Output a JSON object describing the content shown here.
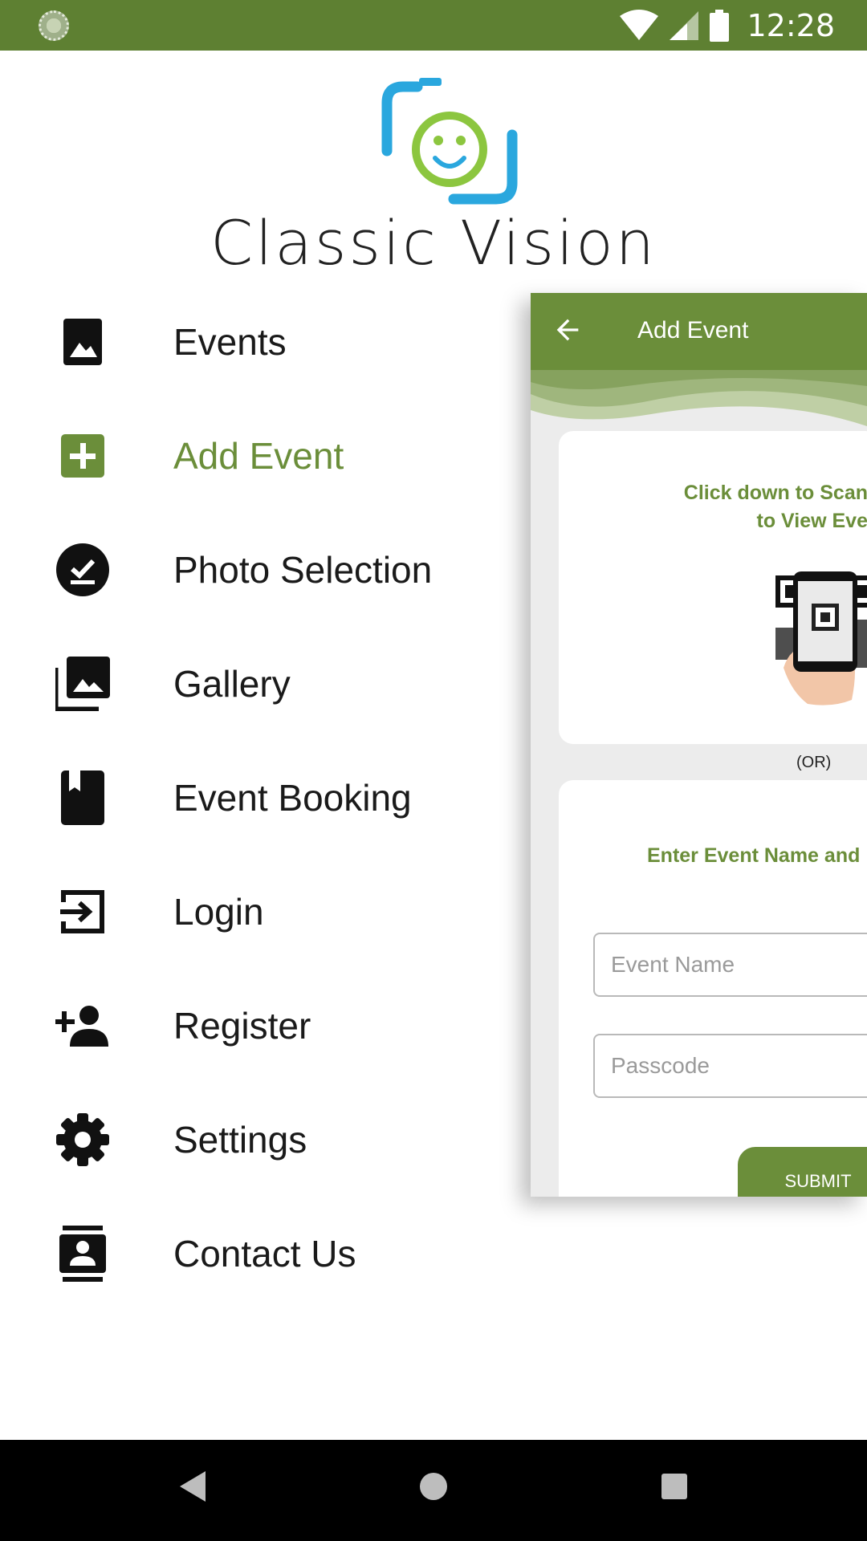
{
  "status_bar": {
    "time": "12:28"
  },
  "brand": {
    "name": "Classic Vision"
  },
  "menu": [
    {
      "id": "events",
      "label": "Events",
      "icon": "photo-icon"
    },
    {
      "id": "add-event",
      "label": "Add Event",
      "icon": "add-box-icon",
      "active": true
    },
    {
      "id": "photo-selection",
      "label": "Photo Selection",
      "icon": "check-circle-icon"
    },
    {
      "id": "gallery",
      "label": "Gallery",
      "icon": "photo-library-icon"
    },
    {
      "id": "event-booking",
      "label": "Event Booking",
      "icon": "book-icon"
    },
    {
      "id": "login",
      "label": "Login",
      "icon": "login-icon"
    },
    {
      "id": "register",
      "label": "Register",
      "icon": "person-add-icon"
    },
    {
      "id": "settings",
      "label": "Settings",
      "icon": "gear-icon"
    },
    {
      "id": "contact-us",
      "label": "Contact Us",
      "icon": "contacts-icon"
    }
  ],
  "behind": {
    "title": "Add Event",
    "scan_line1": "Click down to Scan",
    "scan_line2": "to View Eve",
    "or_text": "(OR)",
    "enter_text": "Enter Event Name and",
    "event_name_placeholder": "Event Name",
    "passcode_placeholder": "Passcode",
    "submit_label": "SUBMIT"
  },
  "colors": {
    "accent": "#6b8e3a",
    "status_bar": "#5e8032"
  }
}
